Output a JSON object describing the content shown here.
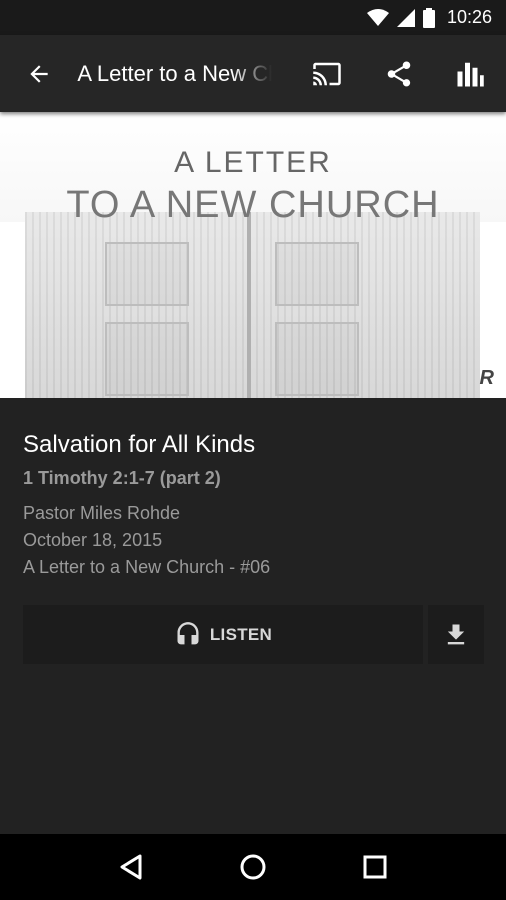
{
  "status_bar": {
    "time": "10:26",
    "icons": [
      "wifi-icon",
      "cell-signal-icon",
      "battery-icon"
    ]
  },
  "app_bar": {
    "title": "A Letter to a New Church",
    "actions": [
      "cast-icon",
      "share-icon",
      "bar-chart-icon"
    ]
  },
  "artwork": {
    "line1": "A LETTER",
    "line2": "TO A NEW CHURCH",
    "logo": "R"
  },
  "sermon": {
    "title": "Salvation for All Kinds",
    "scripture": "1 Timothy 2:1-7 (part 2)",
    "speaker": "Pastor Miles Rohde",
    "date": "October 18, 2015",
    "series": "A Letter to a New Church - #06"
  },
  "actions": {
    "listen_label": "LISTEN"
  },
  "nav_bar": {
    "buttons": [
      "back-triangle-icon",
      "home-circle-icon",
      "recents-square-icon"
    ]
  },
  "colors": {
    "background": "#222222",
    "app_bar": "#262626",
    "button_bg": "#1c1c1c",
    "secondary_text": "#9a9a9a"
  }
}
